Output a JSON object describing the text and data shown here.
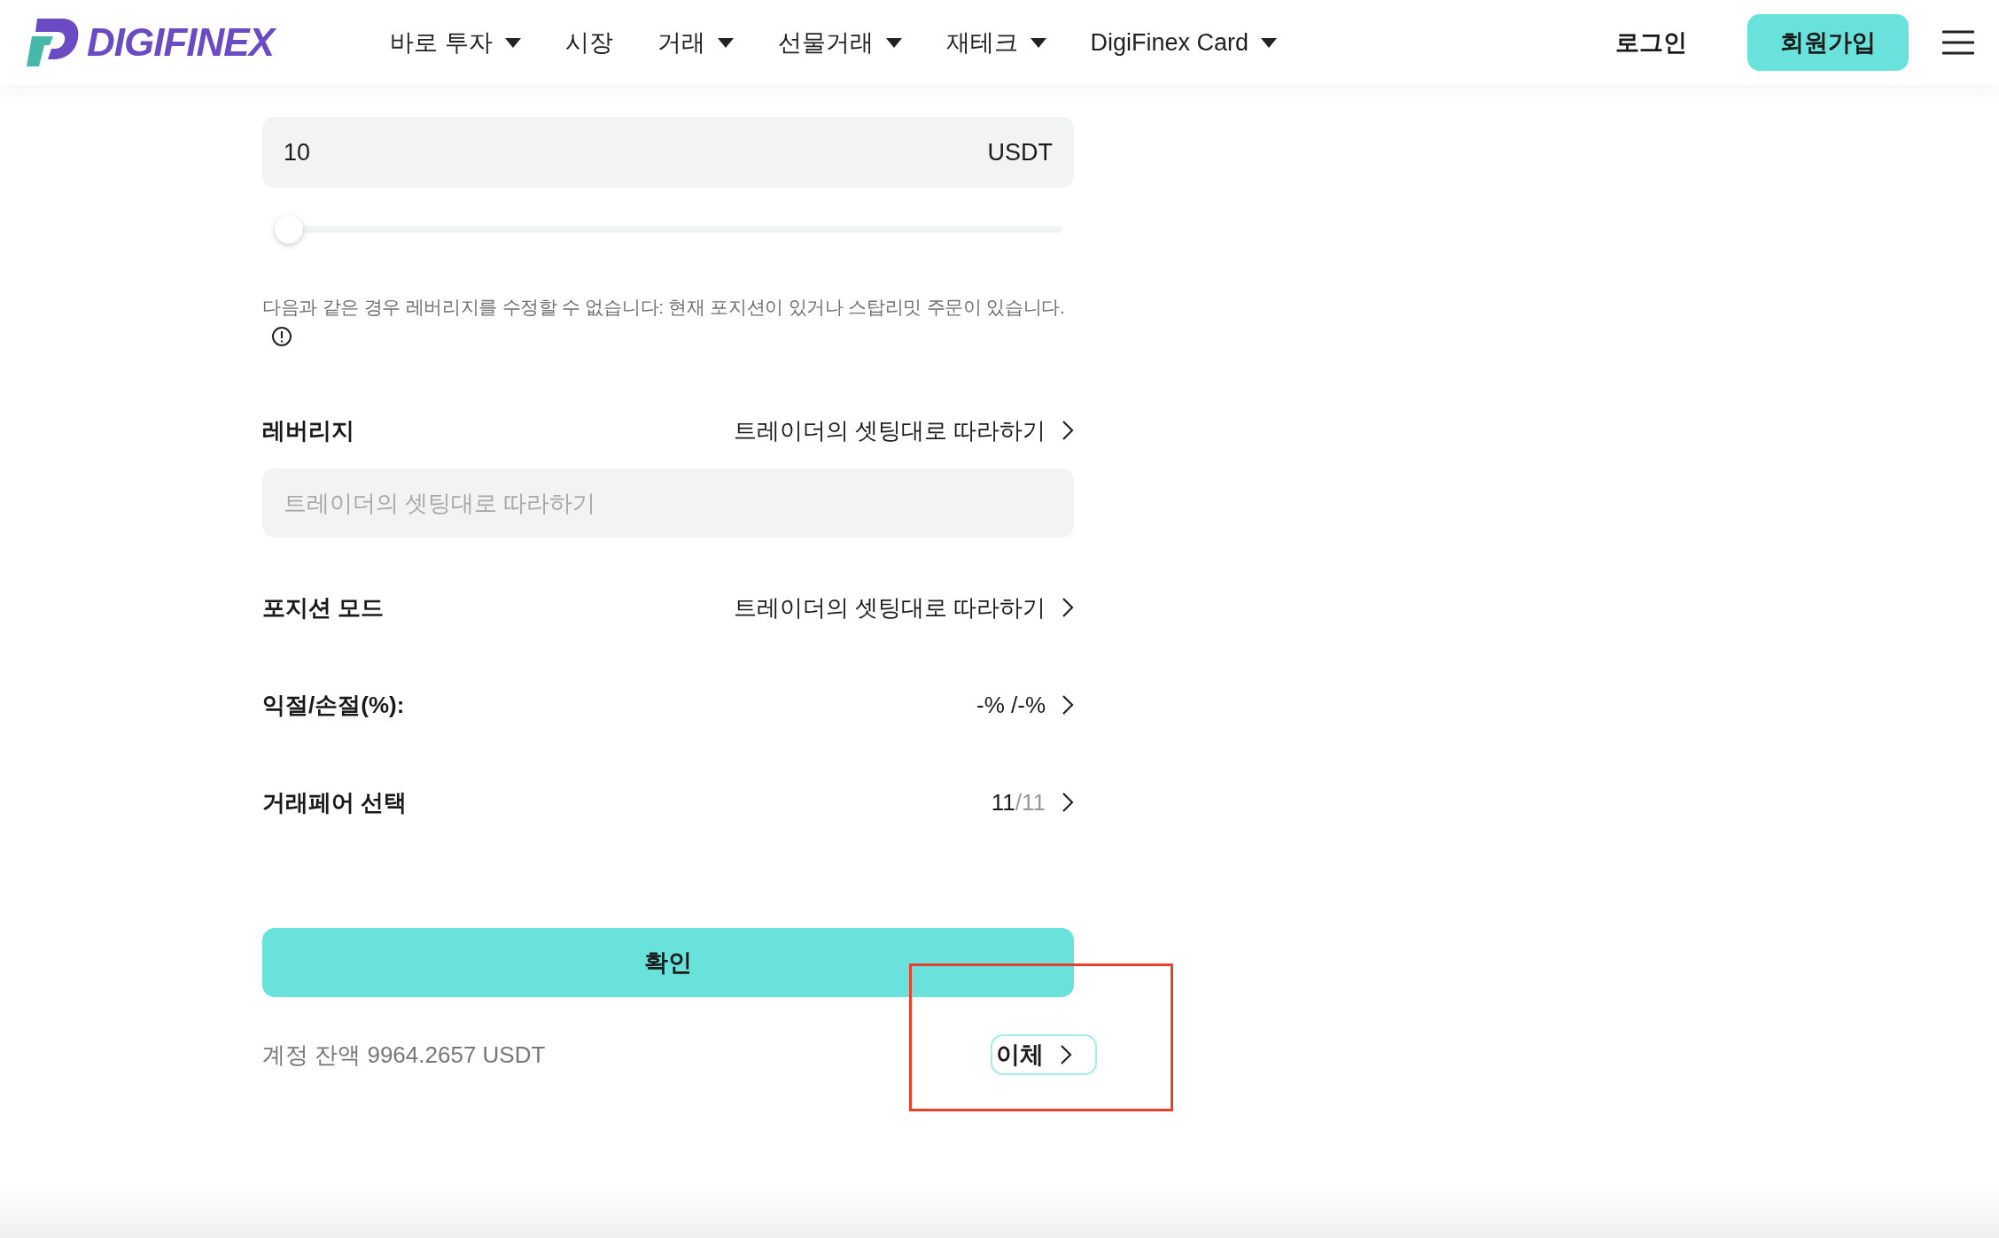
{
  "header": {
    "logo": "DIGIFINEX",
    "nav": [
      {
        "label": "바로 투자",
        "dropdown": true
      },
      {
        "label": "시장",
        "dropdown": false
      },
      {
        "label": "거래",
        "dropdown": true
      },
      {
        "label": "선물거래",
        "dropdown": true
      },
      {
        "label": "재테크",
        "dropdown": true
      },
      {
        "label": "DigiFinex Card",
        "dropdown": true
      }
    ],
    "login": "로그인",
    "signup": "회원가입"
  },
  "amount": {
    "value": "10",
    "unit": "USDT",
    "slider": {
      "level": 0
    }
  },
  "note": "다음과 같은 경우 레버리지를 수정할 수 없습니다: 현재 포지션이 있거나 스탑리밋 주문이 있습니다.",
  "leverage": {
    "label": "레버리지",
    "value": "트레이더의 셋팅대로 따라하기",
    "placeholder": "트레이더의 셋팅대로 따라하기"
  },
  "rows": [
    {
      "label": "포지션 모드",
      "value": "트레이더의 셋팅대로 따라하기"
    },
    {
      "label": "익절/손절(%):",
      "value": "-% /-%"
    },
    {
      "label": "거래페어 선택",
      "value": "11",
      "value_suffix": "/11"
    }
  ],
  "confirm": "확인",
  "balance": "계정 잔액 9964.2657 USDT",
  "transfer": "이체"
}
